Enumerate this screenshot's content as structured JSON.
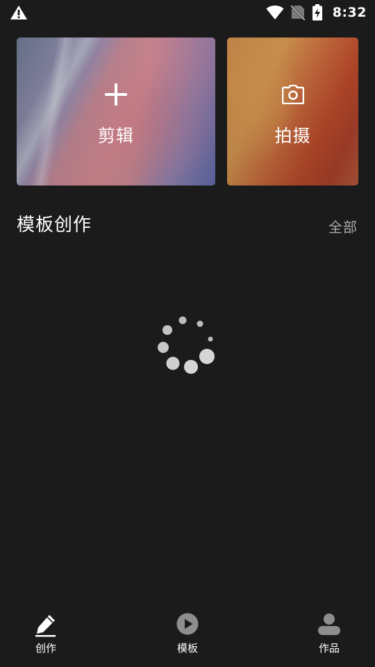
{
  "status_bar": {
    "time": "8:32",
    "icons": [
      "warning-icon",
      "wifi-icon",
      "no-sim-icon",
      "battery-charging-icon"
    ]
  },
  "cards": {
    "edit": {
      "label": "剪辑",
      "icon": "plus-icon"
    },
    "shoot": {
      "label": "拍摄",
      "icon": "camera-icon"
    }
  },
  "section": {
    "title": "模板创作",
    "all_label": "全部"
  },
  "loading": {
    "icon": "loading-spinner-icon"
  },
  "bottom_nav": {
    "items": [
      {
        "label": "创作",
        "icon": "pencil-icon",
        "active": true
      },
      {
        "label": "模板",
        "icon": "play-circle-icon",
        "active": false
      },
      {
        "label": "作品",
        "icon": "person-icon",
        "active": false
      }
    ]
  },
  "colors": {
    "background": "#1b1b1b",
    "text_primary": "#ffffff",
    "text_secondary": "#a9a9a9",
    "nav_icon_inactive": "#8e8e8e"
  }
}
